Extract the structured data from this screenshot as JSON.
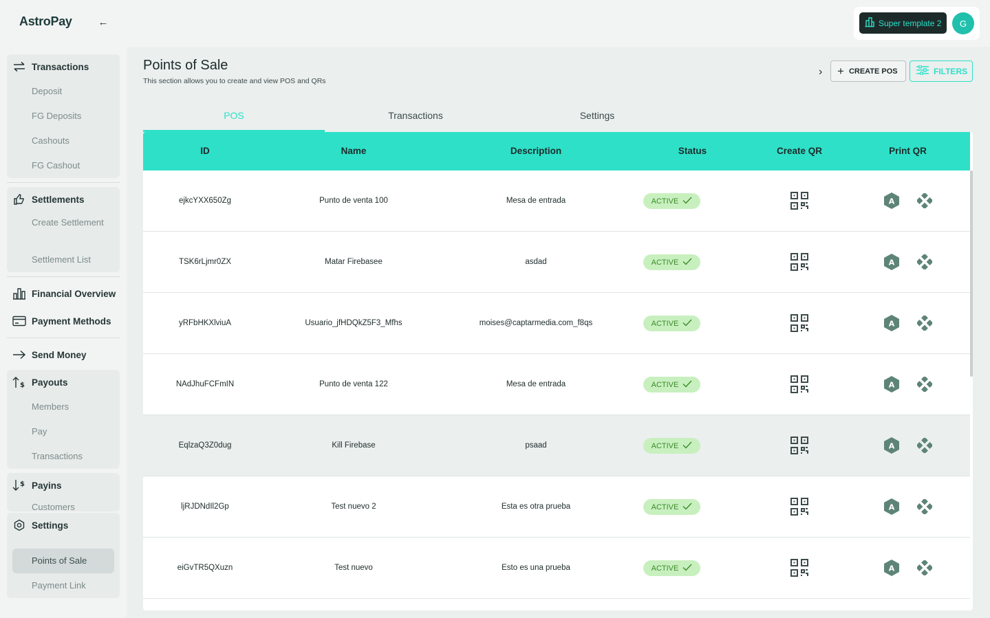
{
  "brand": {
    "logo": "AstroPay",
    "accent": "#2ee0c8"
  },
  "header": {
    "template_label": "Super template 2",
    "avatar_initial": "G"
  },
  "sidebar": {
    "transactions": {
      "label": "Transactions",
      "items": [
        "Deposit",
        "FG Deposits",
        "Cashouts",
        "FG Cashout"
      ]
    },
    "settlements": {
      "label": "Settlements",
      "items": [
        "Create Settlement",
        "Settlement List"
      ]
    },
    "financial_overview": "Financial Overview",
    "payment_methods": "Payment Methods",
    "send_money": "Send Money",
    "payouts": {
      "label": "Payouts",
      "items": [
        "Members",
        "Pay",
        "Transactions"
      ]
    },
    "payins": {
      "label": "Payins",
      "items": [
        "Customers"
      ]
    },
    "settings": {
      "label": "Settings",
      "items": [
        "Points of Sale",
        "Payment Link"
      ]
    }
  },
  "page": {
    "title": "Points of Sale",
    "subtitle": "This section allows you to create and view POS and QRs",
    "create_label": "CREATE POS",
    "filters_label": "FILTERS",
    "tabs": [
      "POS",
      "Transactions",
      "Settings"
    ],
    "columns": [
      "ID",
      "Name",
      "Description",
      "Status",
      "Create QR",
      "Print QR"
    ],
    "rows": [
      {
        "id": "ejkcYXX650Zg",
        "name": "Punto de venta 100",
        "description": "Mesa de entrada",
        "status": "ACTIVE"
      },
      {
        "id": "TSK6rLjmr0ZX",
        "name": "Matar Firebasee",
        "description": "asdad",
        "status": "ACTIVE"
      },
      {
        "id": "yRFbHKXlviuA",
        "name": "Usuario_jfHDQkZ5F3_Mfhs",
        "description": "moises@captarmedia.com_f8qs",
        "status": "ACTIVE"
      },
      {
        "id": "NAdJhuFCFmIN",
        "name": "Punto de venta 122",
        "description": "Mesa de entrada",
        "status": "ACTIVE"
      },
      {
        "id": "EqlzaQ3Z0dug",
        "name": "Kill Firebase",
        "description": "psaad",
        "status": "ACTIVE"
      },
      {
        "id": "ljRJDNdIl2Gp",
        "name": "Test nuevo 2",
        "description": "Esta es otra prueba",
        "status": "ACTIVE"
      },
      {
        "id": "eiGvTR5QXuzn",
        "name": "Test nuevo",
        "description": "Esto es una prueba",
        "status": "ACTIVE"
      }
    ]
  }
}
